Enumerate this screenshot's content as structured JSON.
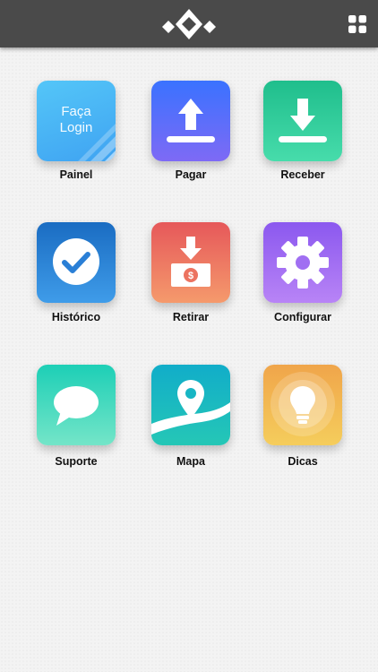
{
  "header": {
    "logo_icon": "diamond-logo-icon",
    "menu_icon": "grid-icon"
  },
  "tiles": [
    {
      "label": "Painel",
      "icon": "login-icon",
      "overlay_line1": "Faça",
      "overlay_line2": "Login",
      "colors": [
        "#4fc3f7",
        "#42a5f5"
      ]
    },
    {
      "label": "Pagar",
      "icon": "upload-icon",
      "colors": [
        "#3d7bff",
        "#7b6cf6"
      ]
    },
    {
      "label": "Receber",
      "icon": "download-icon",
      "colors": [
        "#22c08f",
        "#3fd9a8"
      ]
    },
    {
      "label": "Histórico",
      "icon": "check-icon",
      "colors": [
        "#1e6fc4",
        "#3f9ae8"
      ]
    },
    {
      "label": "Retirar",
      "icon": "cash-withdraw-icon",
      "colors": [
        "#e85c5c",
        "#f5956a"
      ]
    },
    {
      "label": "Configurar",
      "icon": "gear-icon",
      "colors": [
        "#8f5cf0",
        "#b57cf5"
      ]
    },
    {
      "label": "Suporte",
      "icon": "chat-bubble-icon",
      "colors": [
        "#1fd1b8",
        "#6fe3c6"
      ]
    },
    {
      "label": "Mapa",
      "icon": "map-pin-icon",
      "colors": [
        "#12b2c9",
        "#21c4b9"
      ]
    },
    {
      "label": "Dicas",
      "icon": "lightbulb-icon",
      "colors": [
        "#f2a94a",
        "#f4c95a"
      ]
    }
  ]
}
